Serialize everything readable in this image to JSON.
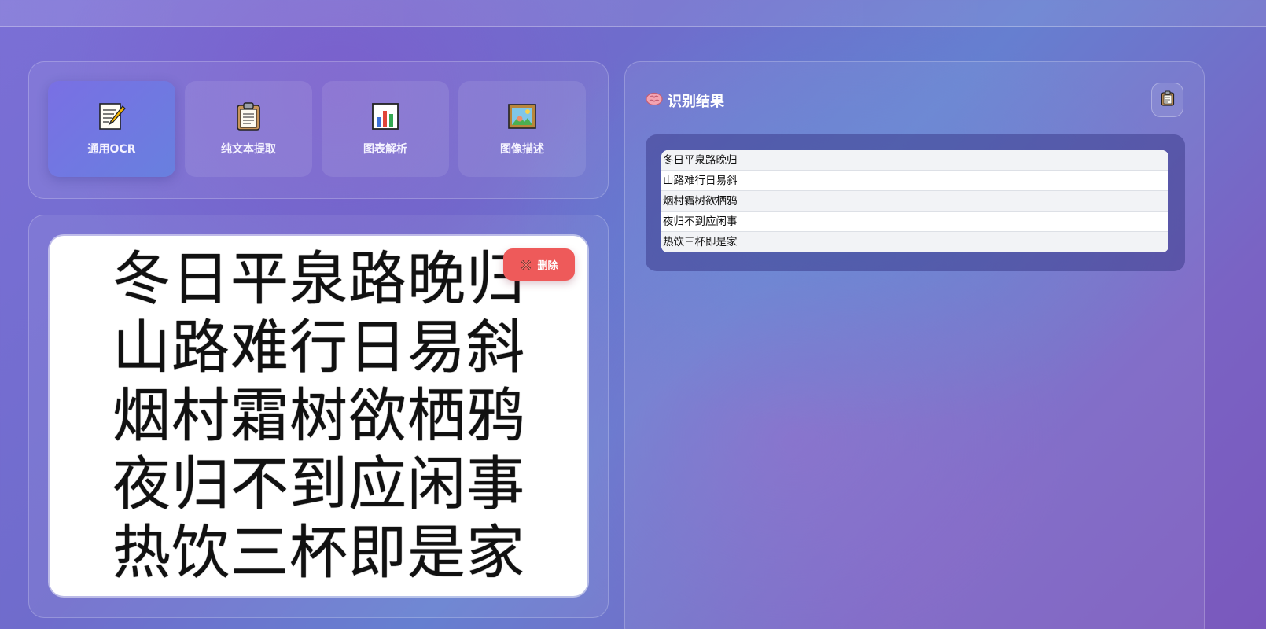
{
  "modes": [
    {
      "label": "通用OCR",
      "icon": "memo-icon",
      "active": true
    },
    {
      "label": "纯文本提取",
      "icon": "clipboard-icon",
      "active": false
    },
    {
      "label": "图表解析",
      "icon": "bar-chart-icon",
      "active": false
    },
    {
      "label": "图像描述",
      "icon": "framed-picture-icon",
      "active": false
    }
  ],
  "preview": {
    "poem_lines": [
      "冬日平泉路晚归",
      "山路难行日易斜",
      "烟村霜树欲栖鸦",
      "夜归不到应闲事",
      "热饮三杯即是家"
    ],
    "delete_label": "删除"
  },
  "result": {
    "title": "识别结果",
    "icon": "brain-icon",
    "copy_icon": "clipboard-icon",
    "rows": [
      "冬日平泉路晚归",
      "山路难行日易斜",
      "烟村霜树欲栖鸦",
      "夜归不到应闲事",
      "热饮三杯即是家"
    ]
  }
}
